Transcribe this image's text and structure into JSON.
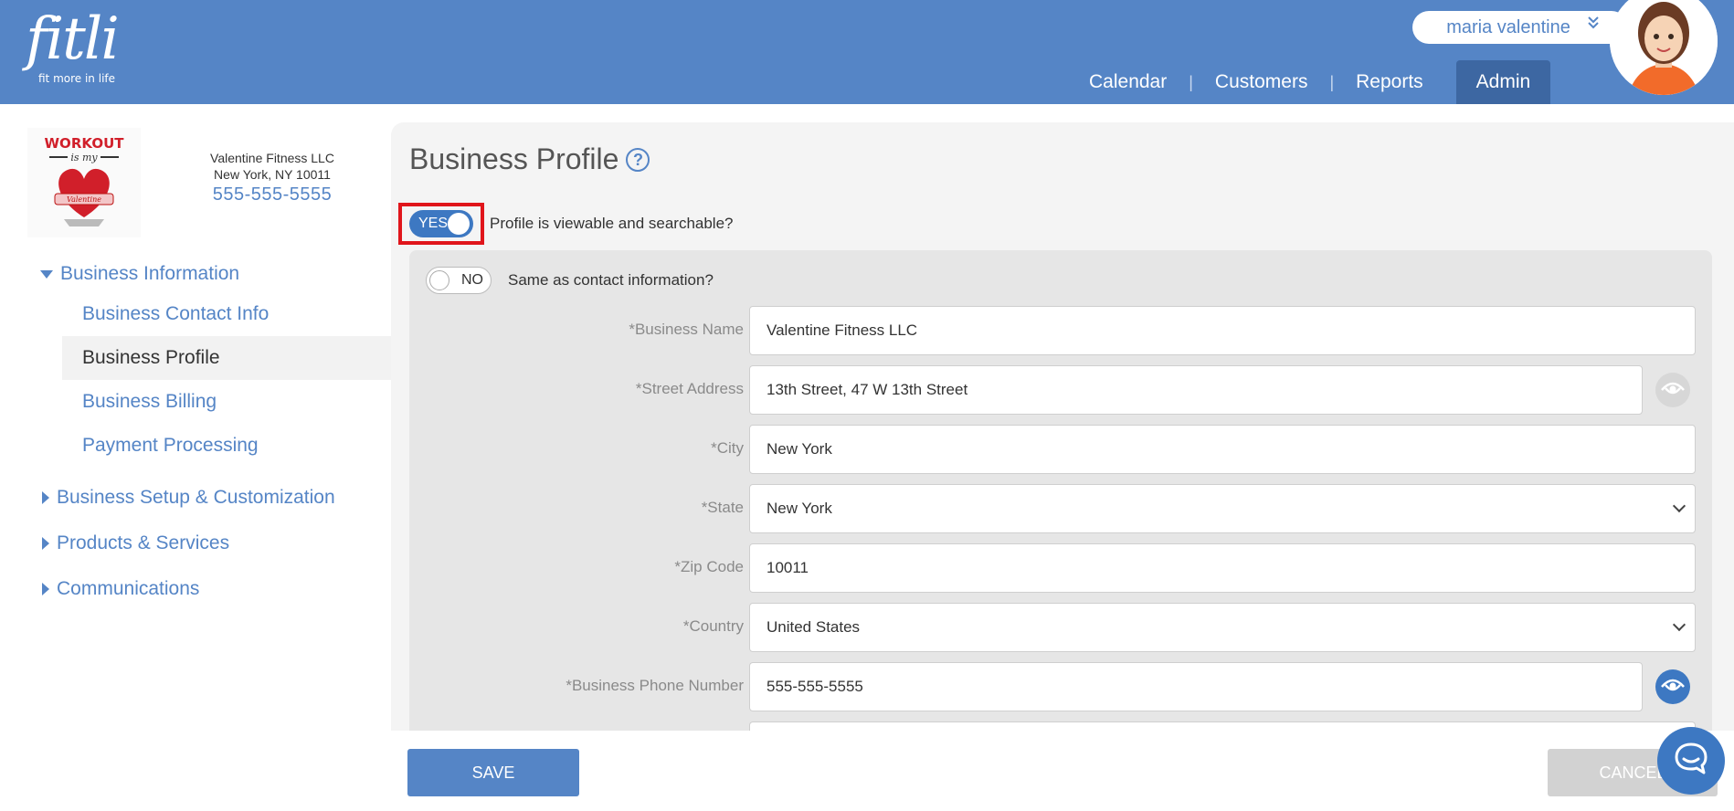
{
  "brand": {
    "name": "fitli",
    "tagline": "fit more in life"
  },
  "user": {
    "name": "maria valentine",
    "chevron": "»"
  },
  "nav": {
    "items": [
      "Calendar",
      "Customers",
      "Reports",
      "Admin"
    ],
    "separator": "|",
    "active": "Admin"
  },
  "business": {
    "name": "Valentine Fitness LLC",
    "location": "New York, NY 10011",
    "phone": "555-555-5555",
    "logo_text": [
      "WORKOUT",
      "is my",
      "Valentine"
    ]
  },
  "sidebar": {
    "group_business_info": "Business Information",
    "sub_items": [
      "Business Contact Info",
      "Business Profile",
      "Business Billing",
      "Payment Processing"
    ],
    "active_sub": "Business Profile",
    "groups_collapsed": [
      "Business Setup & Customization",
      "Products & Services",
      "Communications"
    ]
  },
  "page": {
    "title": "Business Profile",
    "help_glyph": "?",
    "profile_toggle": {
      "state": "YES",
      "label": "Profile is viewable and searchable?"
    },
    "same_contact_toggle": {
      "state": "NO",
      "label": "Same as contact information?"
    }
  },
  "form": {
    "business_name": {
      "label": "*Business Name",
      "value": "Valentine Fitness LLC"
    },
    "street_address": {
      "label": "*Street Address",
      "value": "13th Street, 47 W 13th Street",
      "visibility": "hidden"
    },
    "city": {
      "label": "*City",
      "value": "New York"
    },
    "state": {
      "label": "*State",
      "value": "New York"
    },
    "zip": {
      "label": "*Zip Code",
      "value": "10011"
    },
    "country": {
      "label": "*Country",
      "value": "United States"
    },
    "business_phone": {
      "label": "*Business Phone Number",
      "value": "555-555-5555",
      "visibility": "visible"
    }
  },
  "footer": {
    "save_label": "SAVE",
    "cancel_label": "CANCEL"
  },
  "colors": {
    "header": "#5585c6",
    "nav_active": "#3d67a2",
    "toggle_on": "#3d78c2",
    "highlight": "#e0151b"
  }
}
